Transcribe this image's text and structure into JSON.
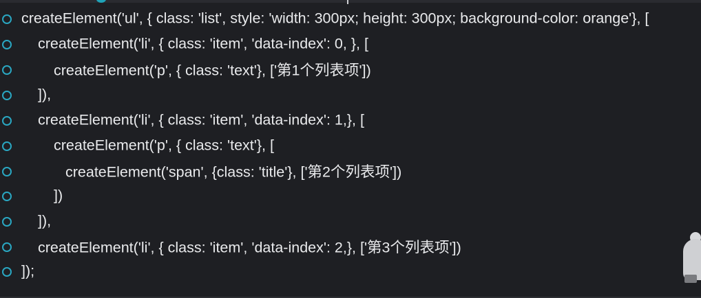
{
  "editor": {
    "lines": [
      "createElement('ul', { class: 'list', style: 'width: 300px; height: 300px; background-color: orange'}, [",
      "createElement('li', { class: 'item', 'data-index': 0, }, [",
      "createElement('p', { class: 'text'}, ['第1个列表项'])",
      "]),",
      "createElement('li', { class: 'item', 'data-index': 1,}, [",
      "createElement('p', { class: 'text'}, [",
      "createElement('span', {class: 'title'}, ['第2个列表项'])",
      "])",
      "]),",
      "createElement('li', { class: 'item', 'data-index': 2,}, ['第3个列表项'])",
      "]);"
    ]
  },
  "colors": {
    "background": "#1e1f23",
    "text": "#e9eaec",
    "marker": "#2aa7c2"
  },
  "icons": {
    "line_marker": "circle-outline-icon",
    "mascot": "mascot-icon"
  }
}
